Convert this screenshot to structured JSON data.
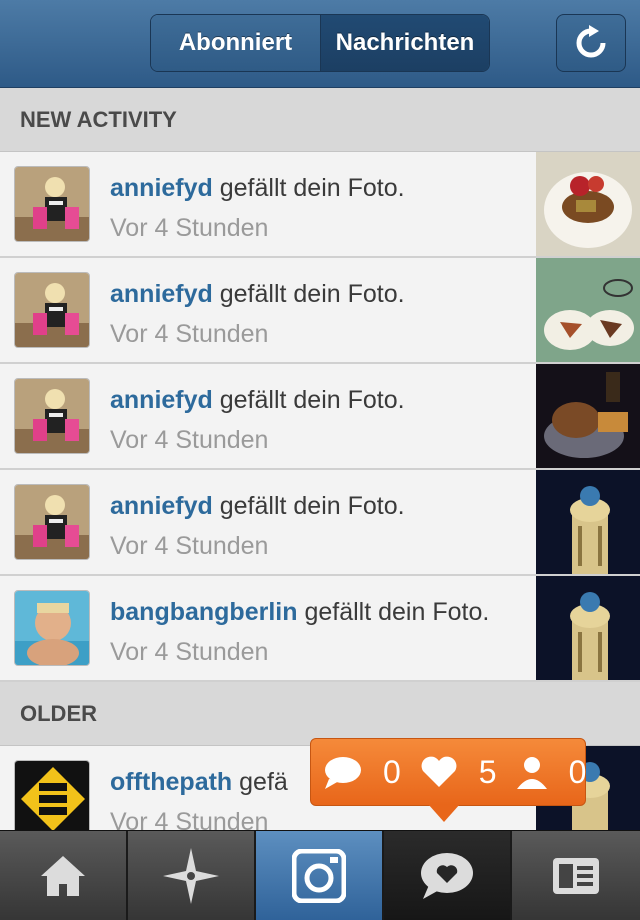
{
  "header": {
    "tabs": [
      {
        "label": "Abonniert",
        "active": false
      },
      {
        "label": "Nachrichten",
        "active": true
      }
    ],
    "refresh_icon": "refresh-icon"
  },
  "sections": {
    "new_activity": "NEW ACTIVITY",
    "older": "OLDER"
  },
  "activity": [
    {
      "user": "anniefyd",
      "action": "gefällt dein Foto.",
      "time": "Vor 4 Stunden"
    },
    {
      "user": "anniefyd",
      "action": "gefällt dein Foto.",
      "time": "Vor 4 Stunden"
    },
    {
      "user": "anniefyd",
      "action": "gefällt dein Foto.",
      "time": "Vor 4 Stunden"
    },
    {
      "user": "anniefyd",
      "action": "gefällt dein Foto.",
      "time": "Vor 4 Stunden"
    },
    {
      "user": "bangbangberlin",
      "action": "gefällt dein Foto.",
      "time": "Vor 4 Stunden"
    }
  ],
  "older": [
    {
      "user": "offthepath",
      "action": "gefä",
      "time": "Vor 4 Stunden"
    }
  ],
  "notification": {
    "comments": "0",
    "likes": "5",
    "followers": "0"
  },
  "tabbar": [
    "home-icon",
    "explore-icon",
    "camera-icon",
    "news-icon",
    "profile-icon"
  ],
  "colors": {
    "accent": "#2d6a9c",
    "header": "#3a6792",
    "bubble": "#f07a2a"
  }
}
